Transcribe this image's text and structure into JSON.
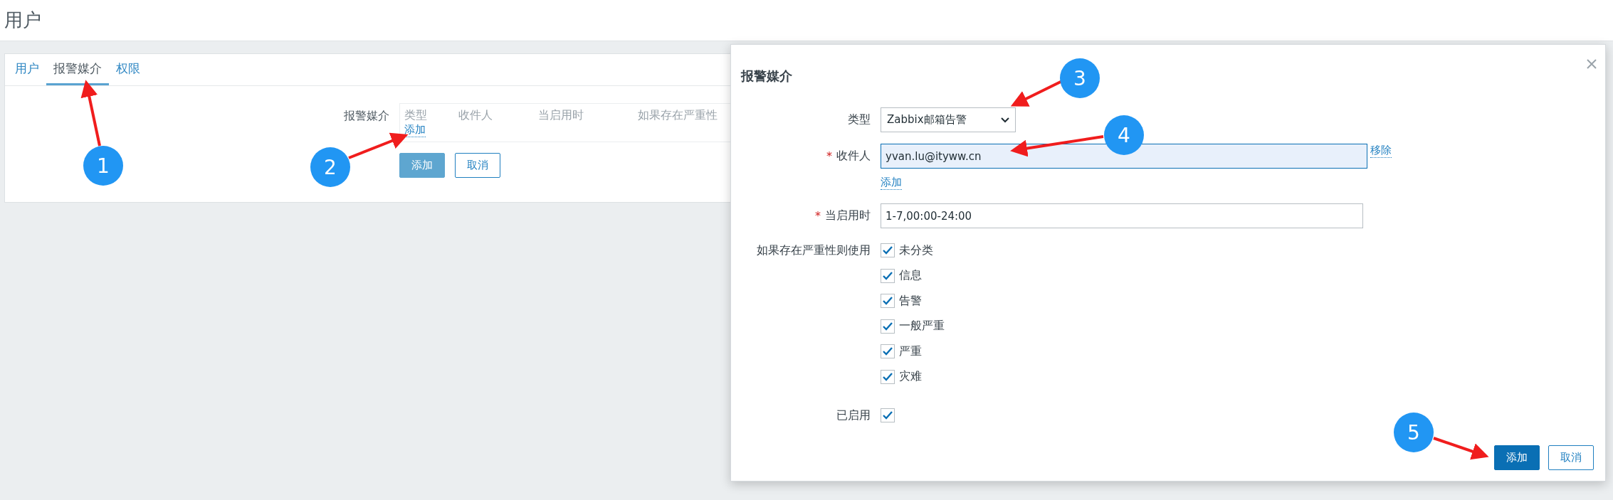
{
  "page_title": "用户",
  "tabs": [
    {
      "label": "用户",
      "selected": false
    },
    {
      "label": "报警媒介",
      "selected": true
    },
    {
      "label": "权限",
      "selected": false
    }
  ],
  "media_form": {
    "label": "报警媒介",
    "columns": [
      "类型",
      "收件人",
      "当启用时",
      "如果存在严重性"
    ],
    "add_link": "添加",
    "buttons": [
      {
        "label": "添加",
        "kind": "primary"
      },
      {
        "label": "取消",
        "kind": "secondary"
      }
    ]
  },
  "dialog": {
    "title": "报警媒介",
    "type": {
      "label": "类型",
      "value": "Zabbix邮箱告警"
    },
    "send_to": {
      "label": "收件人",
      "required_mark": "*",
      "value": "yvan.lu@ityww.cn",
      "remove_link": "移除",
      "add_link": "添加"
    },
    "when_active": {
      "label": "当启用时",
      "required_mark": "*",
      "value": "1-7,00:00-24:00"
    },
    "severity": {
      "label": "如果存在严重性则使用",
      "options": [
        {
          "label": "未分类",
          "checked": true
        },
        {
          "label": "信息",
          "checked": true
        },
        {
          "label": "告警",
          "checked": true
        },
        {
          "label": "一般严重",
          "checked": true
        },
        {
          "label": "严重",
          "checked": true
        },
        {
          "label": "灾难",
          "checked": true
        }
      ]
    },
    "enabled": {
      "label": "已启用",
      "checked": true
    },
    "buttons": [
      {
        "label": "添加",
        "kind": "primary"
      },
      {
        "label": "取消",
        "kind": "secondary"
      }
    ]
  },
  "annotations": [
    {
      "label": "1"
    },
    {
      "label": "2"
    },
    {
      "label": "3"
    },
    {
      "label": "4"
    },
    {
      "label": "5"
    }
  ]
}
